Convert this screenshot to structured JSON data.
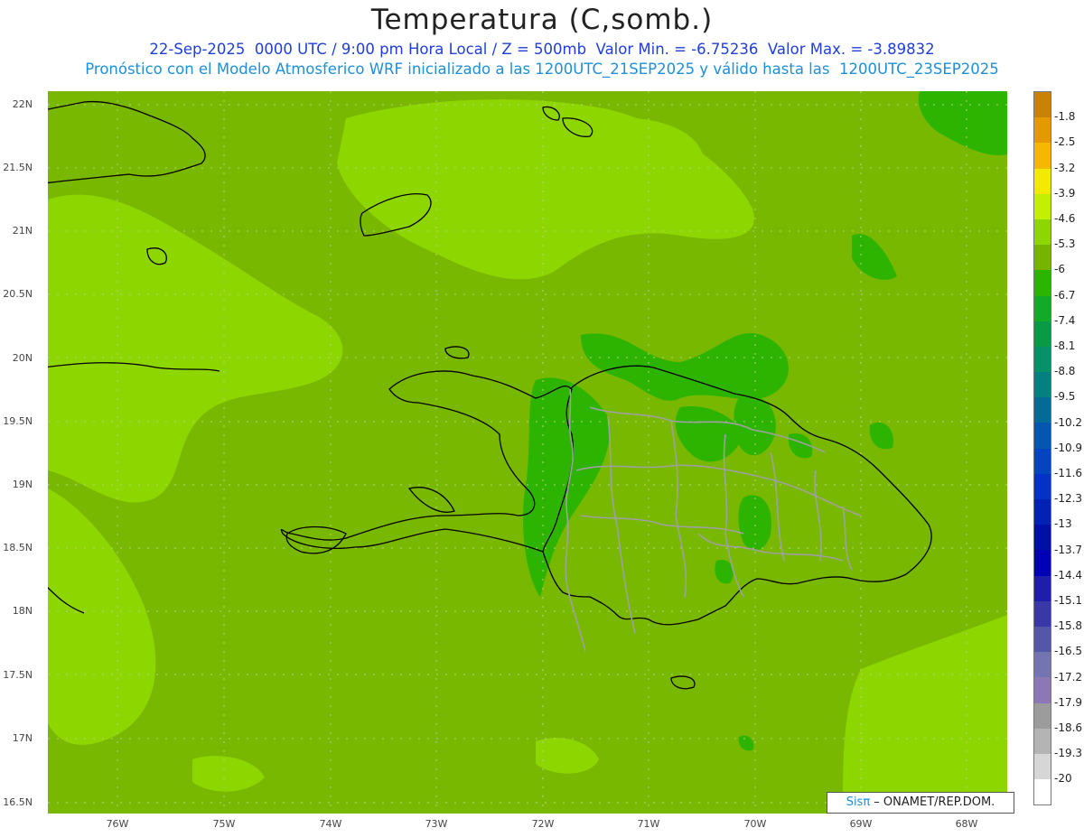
{
  "header": {
    "title": "Temperatura (C,somb.)",
    "line1": "22-Sep-2025  0000 UTC / 9:00 pm Hora Local / Z = 500mb  Valor Min. = -6.75236  Valor Max. = -3.89832",
    "line2": "Pronóstico con el Modelo Atmosferico WRF inicializado a las 1200UTC_21SEP2025 y válido hasta las  1200UTC_23SEP2025"
  },
  "axes": {
    "lat_labels": [
      "22N",
      "21.5N",
      "21N",
      "20.5N",
      "20N",
      "19.5N",
      "19N",
      "18.5N",
      "18N",
      "17.5N",
      "17N",
      "16.5N"
    ],
    "lon_labels": [
      "76W",
      "75W",
      "74W",
      "73W",
      "72W",
      "71W",
      "70W",
      "69W",
      "68W"
    ]
  },
  "credit": {
    "brand": "Sisπ",
    "text": " – ONAMET/REP.DOM."
  },
  "colorbar": {
    "labels": [
      "-1.8",
      "-2.5",
      "-3.2",
      "-3.9",
      "-4.6",
      "-5.3",
      "-6",
      "-6.7",
      "-7.4",
      "-8.1",
      "-8.8",
      "-9.5",
      "-10.2",
      "-10.9",
      "-11.6",
      "-12.3",
      "-13",
      "-13.7",
      "-14.4",
      "-15.1",
      "-15.8",
      "-16.5",
      "-17.2",
      "-17.9",
      "-18.6",
      "-19.3",
      "-20"
    ],
    "colors": [
      "#c8820a",
      "#e39a00",
      "#f5b800",
      "#f2ea00",
      "#c4f000",
      "#8ed600",
      "#76b400",
      "#2db400",
      "#14aa28",
      "#0a9a46",
      "#089068",
      "#067f80",
      "#066a96",
      "#0556ac",
      "#0444bc",
      "#0333c4",
      "#0222b4",
      "#0010a4",
      "#0000b4",
      "#1e1ea8",
      "#3a38a4",
      "#5656a8",
      "#7474b2",
      "#8c78b4",
      "#9c9c9c",
      "#b4b4b4",
      "#d6d6d6",
      "#ffffff"
    ]
  }
}
